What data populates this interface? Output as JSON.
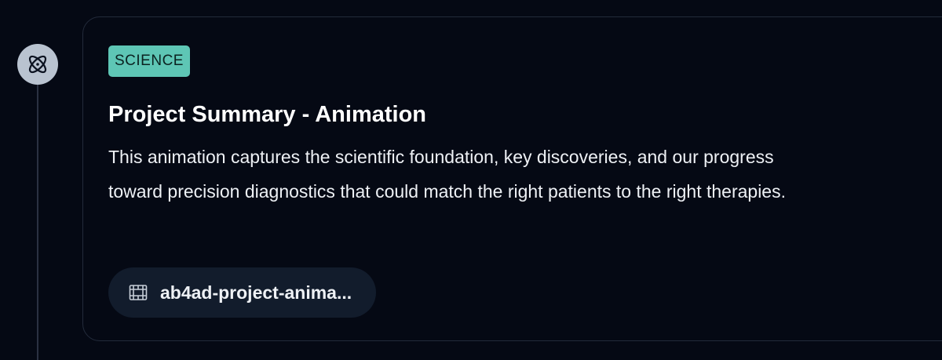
{
  "timeline": {
    "node_icon": "atom-icon"
  },
  "card": {
    "category_badge": "SCIENCE",
    "title": "Project Summary - Animation",
    "description": "This animation captures the scientific foundation, key discoveries, and our progress toward precision diagnostics that could match the right patients to the right therapies.",
    "attachment": {
      "icon": "film-icon",
      "filename": "ab4ad-project-anima..."
    }
  },
  "colors": {
    "background": "#050914",
    "badge": "#5ec6b5",
    "card_border": "#232b3b",
    "attachment_bg": "#121c2c",
    "node_bg": "#b9c3d0"
  }
}
